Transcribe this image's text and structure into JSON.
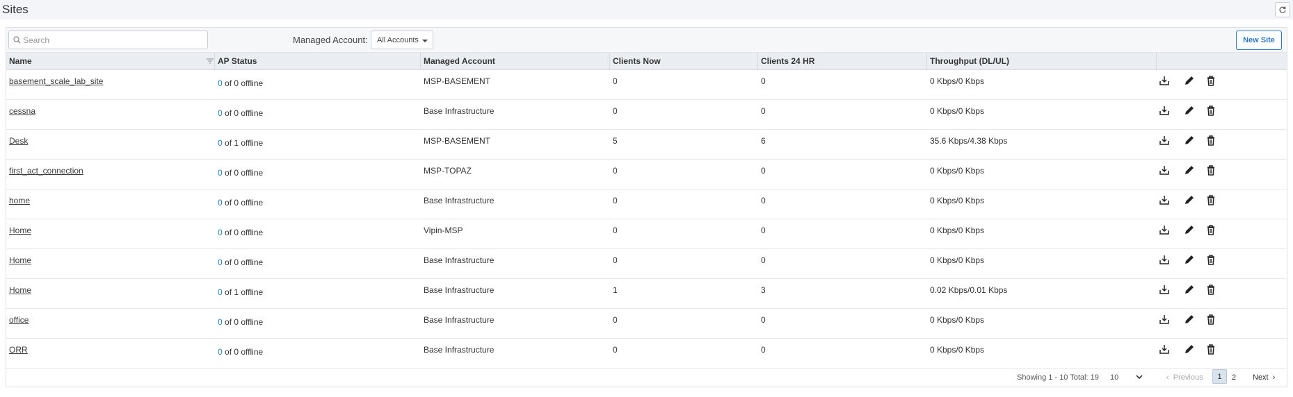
{
  "page": {
    "title": "Sites"
  },
  "toolbar": {
    "search_placeholder": "Search",
    "managed_account_label": "Managed Account:",
    "managed_account_value": "All Accounts",
    "new_site_label": "New Site"
  },
  "table": {
    "columns": [
      "Name",
      "AP Status",
      "Managed Account",
      "Clients Now",
      "Clients 24 HR",
      "Throughput (DL/UL)"
    ],
    "rows": [
      {
        "name": "basement_scale_lab_site",
        "ap_up": "0",
        "ap_rest": "of 0 offline",
        "account": "MSP-BASEMENT",
        "clients_now": "0",
        "clients_24": "0",
        "throughput": "0 Kbps/0 Kbps"
      },
      {
        "name": "cessna",
        "ap_up": "0",
        "ap_rest": "of 0 offline",
        "account": "Base Infrastructure",
        "clients_now": "0",
        "clients_24": "0",
        "throughput": "0 Kbps/0 Kbps"
      },
      {
        "name": "Desk",
        "ap_up": "0",
        "ap_rest": "of 1 offline",
        "account": "MSP-BASEMENT",
        "clients_now": "5",
        "clients_24": "6",
        "throughput": "35.6 Kbps/4.38 Kbps"
      },
      {
        "name": "first_act_connection",
        "ap_up": "0",
        "ap_rest": "of 0 offline",
        "account": "MSP-TOPAZ",
        "clients_now": "0",
        "clients_24": "0",
        "throughput": "0 Kbps/0 Kbps"
      },
      {
        "name": "home",
        "ap_up": "0",
        "ap_rest": "of 0 offline",
        "account": "Base Infrastructure",
        "clients_now": "0",
        "clients_24": "0",
        "throughput": "0 Kbps/0 Kbps"
      },
      {
        "name": "Home",
        "ap_up": "0",
        "ap_rest": "of 0 offline",
        "account": "Vipin-MSP",
        "clients_now": "0",
        "clients_24": "0",
        "throughput": "0 Kbps/0 Kbps"
      },
      {
        "name": "Home",
        "ap_up": "0",
        "ap_rest": "of 0 offline",
        "account": "Base Infrastructure",
        "clients_now": "0",
        "clients_24": "0",
        "throughput": "0 Kbps/0 Kbps"
      },
      {
        "name": "Home",
        "ap_up": "0",
        "ap_rest": "of 1 offline",
        "account": "Base Infrastructure",
        "clients_now": "1",
        "clients_24": "3",
        "throughput": "0.02 Kbps/0.01 Kbps"
      },
      {
        "name": "office",
        "ap_up": "0",
        "ap_rest": "of 0 offline",
        "account": "Base Infrastructure",
        "clients_now": "0",
        "clients_24": "0",
        "throughput": "0 Kbps/0 Kbps"
      },
      {
        "name": "ORR",
        "ap_up": "0",
        "ap_rest": "of 0 offline",
        "account": "Base Infrastructure",
        "clients_now": "0",
        "clients_24": "0",
        "throughput": "0 Kbps/0 Kbps"
      }
    ]
  },
  "pagination": {
    "showing": "Showing 1 - 10 Total: 19",
    "per_page": "10",
    "previous": "Previous",
    "page1": "1",
    "page2": "2",
    "next": "Next"
  },
  "colors": {
    "accent": "#2b7ac3",
    "ap_up_count": "#2a7fb8",
    "header_bg": "#eaeef3"
  },
  "icons": [
    "refresh-icon",
    "search-icon",
    "sort-filter-icon",
    "download-icon",
    "edit-icon",
    "delete-icon",
    "chevron-down-icon"
  ]
}
